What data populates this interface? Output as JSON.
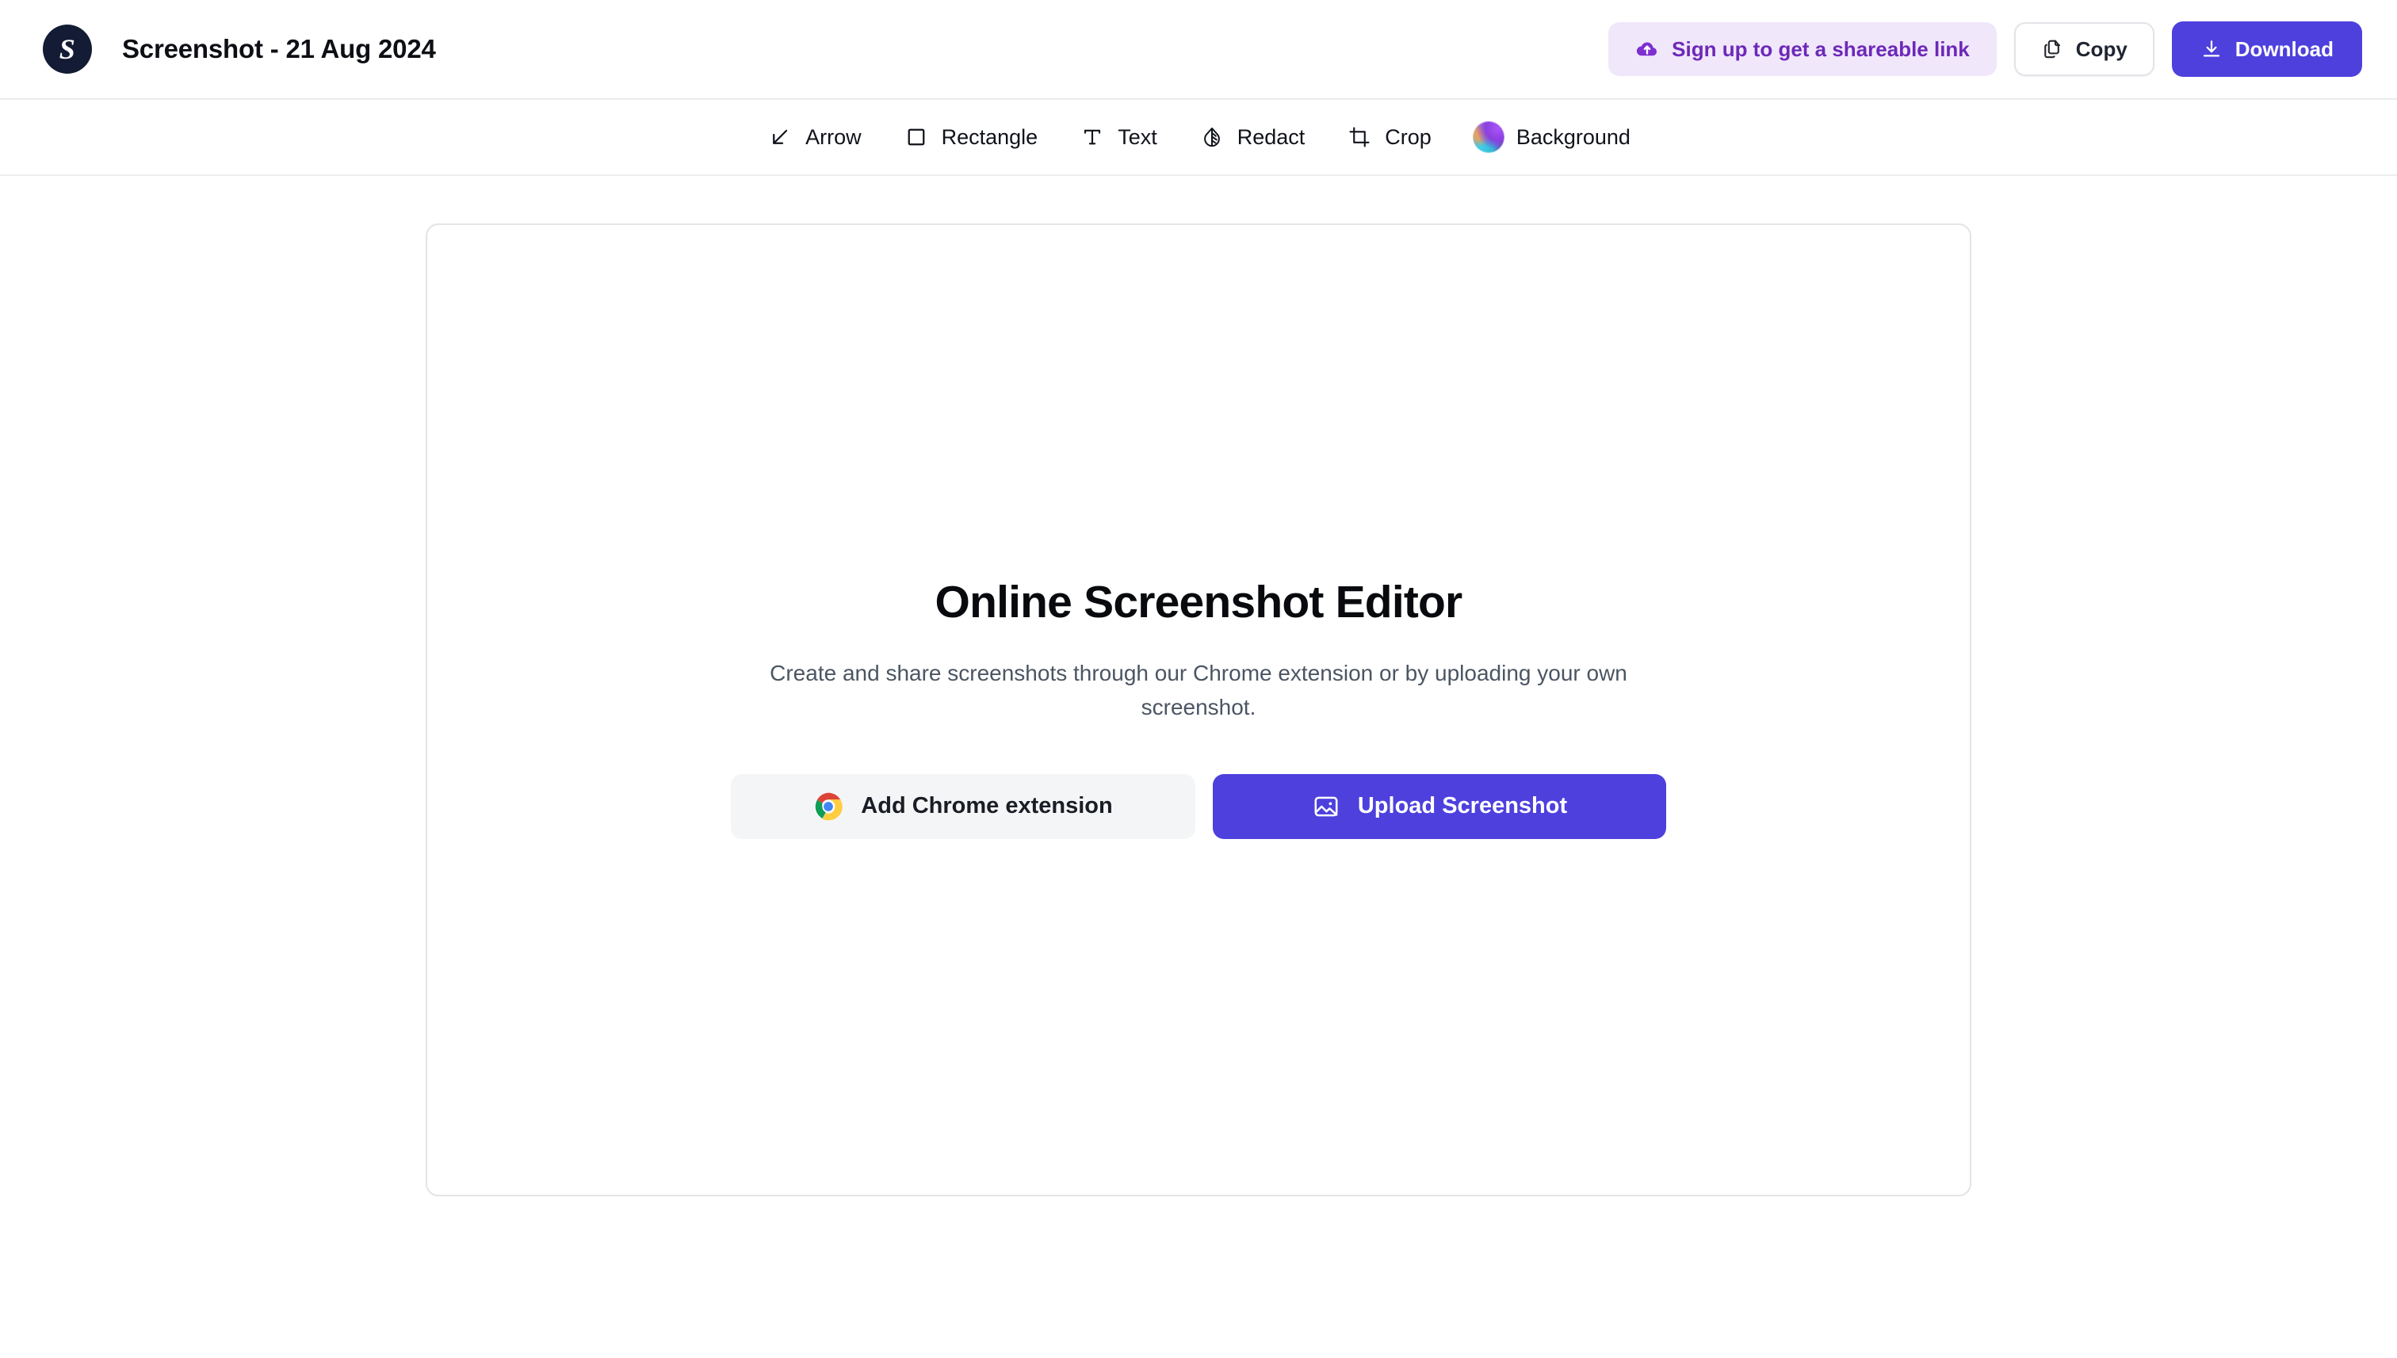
{
  "header": {
    "logo_letter": "S",
    "logo_name": "screenshot-logo",
    "title": "Screenshot - 21 Aug 2024",
    "actions": {
      "signup_label": "Sign up to get a shareable link",
      "signup_icon": "cloud-upload-icon",
      "copy_label": "Copy",
      "copy_icon": "copy-icon",
      "download_label": "Download",
      "download_icon": "download-icon"
    }
  },
  "toolbar": {
    "tools": [
      {
        "label": "Arrow",
        "icon": "arrow-down-left-icon"
      },
      {
        "label": "Rectangle",
        "icon": "rectangle-icon"
      },
      {
        "label": "Text",
        "icon": "text-t-icon"
      },
      {
        "label": "Redact",
        "icon": "droplet-contrast-icon"
      },
      {
        "label": "Crop",
        "icon": "crop-icon"
      },
      {
        "label": "Background",
        "icon": "gradient-sphere-icon"
      }
    ]
  },
  "canvas": {
    "empty_state": {
      "title": "Online Screenshot Editor",
      "subtitle": "Create and share screenshots through our Chrome extension or by uploading your own screenshot.",
      "chrome_button_label": "Add Chrome extension",
      "chrome_button_icon": "chrome-logo-icon",
      "upload_button_label": "Upload Screenshot",
      "upload_button_icon": "image-icon"
    }
  },
  "colors": {
    "accent_indigo": "#4e40dd",
    "signup_bg": "#f0e7fb",
    "signup_text": "#6d28b8",
    "logo_navy": "#131c34",
    "subtitle_gray": "#4b5563",
    "border_gray": "#e2e4e6"
  }
}
